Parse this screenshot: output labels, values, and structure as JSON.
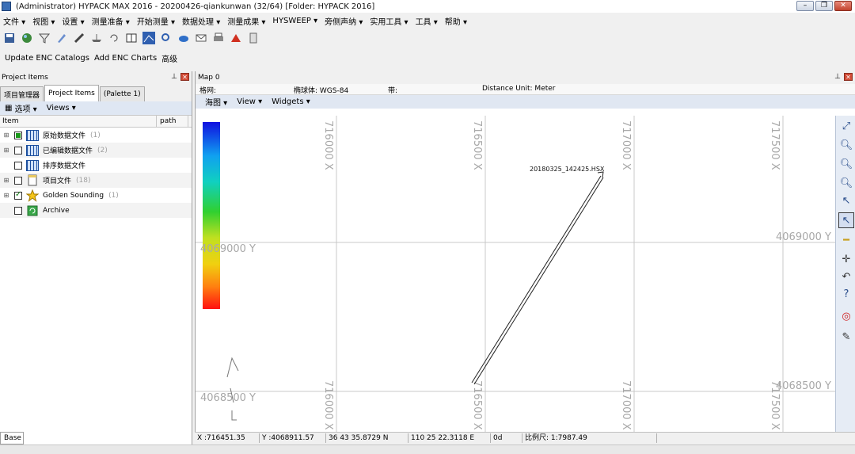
{
  "window": {
    "title": "(Administrator) HYPACK MAX 2016 - 20200426-qiankunwan (32/64)  [Folder: HYPACK 2016]",
    "min": "–",
    "max": "❐",
    "close": "✕"
  },
  "menu": [
    "文件 ▾",
    "视图 ▾",
    "设置 ▾",
    "测量准备 ▾",
    "开始测量 ▾",
    "数据处理 ▾",
    "测量成果 ▾",
    "HYSWEEP ▾",
    "旁侧声纳 ▾",
    "实用工具 ▾",
    "工具 ▾",
    "帮助 ▾"
  ],
  "toolbar2": [
    "Update ENC Catalogs",
    "Add ENC Charts",
    "高级"
  ],
  "left_panel": {
    "title": "Project Items",
    "tabs": [
      "项目管理器",
      "Project Items",
      "(Palette 1)"
    ],
    "options_label": "选项 ▾",
    "views_label": "Views ▾",
    "col_item": "Item",
    "col_path": "path",
    "rows": [
      {
        "label": "原始数据文件",
        "count": "(1)"
      },
      {
        "label": "已编辑数据文件",
        "count": "(2)"
      },
      {
        "label": "排序数据文件",
        "count": ""
      },
      {
        "label": "项目文件",
        "count": "(18)"
      },
      {
        "label": "Golden Sounding",
        "count": "(1)"
      },
      {
        "label": "Archive",
        "count": ""
      }
    ],
    "base_tab": "Base"
  },
  "map": {
    "title": "Map 0",
    "grid_label": "格网:",
    "ellipsoid_label": "椭球体: WGS-84",
    "zone_label": "带:",
    "distance_unit": "Distance Unit: Meter",
    "menu": [
      "海图 ▾",
      "View ▾",
      "Widgets ▾"
    ],
    "x_labels": [
      "716000 X",
      "716500 X",
      "717000 X",
      "717500 X"
    ],
    "y_labels_left": [
      "4069000 Y",
      "4068500 Y"
    ],
    "y_labels_right": [
      "4069000 Y",
      "4068500 Y"
    ],
    "line_label": "20180325_142425.HSX"
  },
  "status": {
    "x": "X :716451.35",
    "y": "Y :4068911.57",
    "lat": "36 43 35.8729 N",
    "lon": "110 25 22.3118 E",
    "heading": "0d",
    "scale": "比例尺: 1:7987.49"
  },
  "colors": {
    "scale_top": "#1010e0",
    "scale_bottom": "#ff1010",
    "grid": "#c8c8c8",
    "label": "#a8a8a8"
  }
}
